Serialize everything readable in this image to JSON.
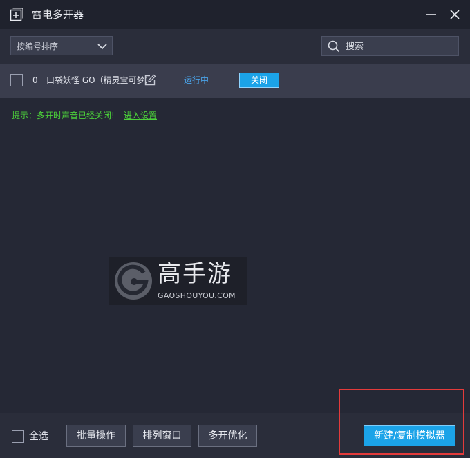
{
  "window": {
    "title": "雷电多开器",
    "app_icon": "add-window-icon",
    "minimize_icon": "minimize-icon",
    "close_icon": "close-icon"
  },
  "toolbar": {
    "sort_label": "按编号排序",
    "sort_icon": "chevron-down-icon",
    "search_placeholder": "搜索",
    "search_icon": "search-icon"
  },
  "instances": [
    {
      "index": "0",
      "name": "口袋妖怪 GO（精灵宝可梦）",
      "status": "运行中",
      "action_label": "关闭",
      "edit_icon": "edit-icon"
    }
  ],
  "hint": {
    "text": "提示：多开时声音已经关闭!",
    "link": "进入设置"
  },
  "watermark": {
    "title": "高手游",
    "subtitle": "GAOSHOUYOU.COM"
  },
  "footer": {
    "select_all": "全选",
    "batch": "批量操作",
    "arrange": "排列窗口",
    "optimize": "多开优化",
    "new_copy": "新建/复制模拟器"
  },
  "colors": {
    "background": "#252835",
    "accent": "#1ba3e8",
    "status": "#4aa3e8",
    "hint": "#4cd13a",
    "highlight": "#e33b3b"
  }
}
